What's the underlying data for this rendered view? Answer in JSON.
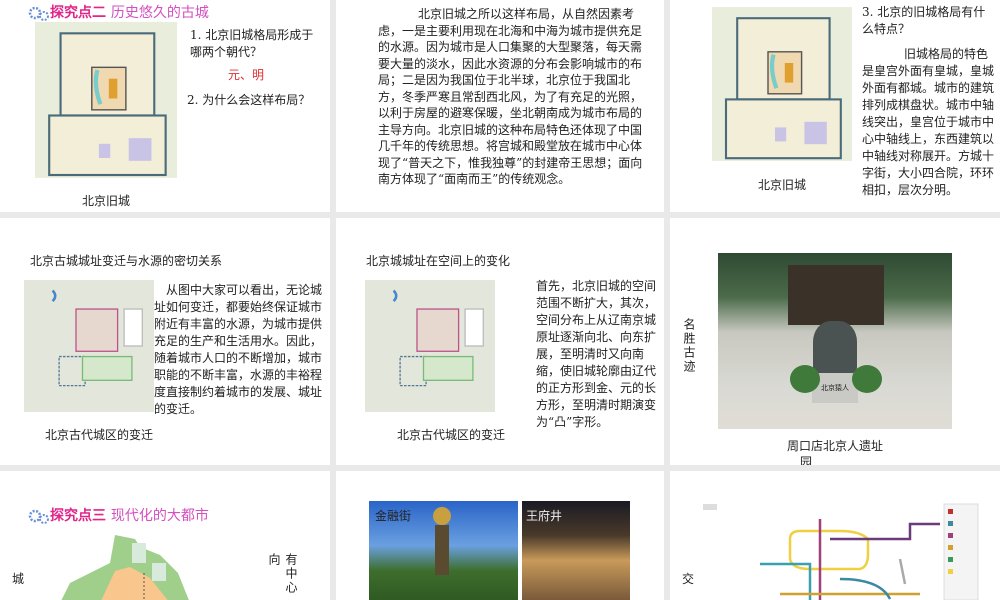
{
  "slide1": {
    "title_bold": "探究点二",
    "title_rest": "历史悠久的古城",
    "q1": "1. 北京旧城格局形成于哪两个朝代？",
    "answer": "元、明",
    "q2": "2. 为什么会这样布局？",
    "caption": "北京旧城"
  },
  "slide2": {
    "text": "北京旧城之所以这样布局，从自然因素考虑，一是主要利用现在北海和中海为城市提供充足的水源。因为城市是人口集聚的大型聚落，每天需要大量的淡水，因此水资源的分布会影响城市的布局；二是因为我国位于北半球，北京位于我国北方，冬季严寒且常刮西北风，为了有充足的光照，以利于房屋的避寒保暖，坐北朝南成为城市布局的主导方向。北京旧城的这种布局特色还体现了中国几千年的传统思想。将宫城和殿堂放在城市中心体现了“普天之下，惟我独尊”的封建帝王思想；面向南方体现了“面南而王”的传统观念。"
  },
  "slide3": {
    "q3": "3. 北京的旧城格局有什么特点？",
    "text": "旧城格局的特色是皇宫外面有皇城，皇城外面有都城。城市的建筑排列成棋盘状。城市中轴线突出，皇宫位于城市中心中轴线上，东西建筑以中轴线对称展开。方城十字街，大小四合院，环环相扣，层次分明。",
    "caption": "北京旧城"
  },
  "slide4": {
    "heading": "北京古城城址变迁与水源的密切关系",
    "text": "从图中大家可以看出，无论城址如何变迁，都要始终保证城市附近有丰富的水源，为城市提供充足的生产和生活用水。因此，随着城市人口的不断增加，城市职能的不断丰富，水源的丰裕程度直接制约着城市的发展、城址的变迁。",
    "caption": "北京古代城区的变迁"
  },
  "slide5": {
    "heading": "北京城城址在空间上的变化",
    "text": "首先，北京旧城的空间范围不断扩大，其次，空间分布上从辽南京城原址逐渐向北、向东扩展，至明清时又向南缩，使旧城轮廓由辽代的正方形到金、元的长方形，至明清时期演变为“凸”字形。",
    "caption": "北京古代城区的变迁"
  },
  "slide6": {
    "side_label": "名胜古迹",
    "caption": "周口店北京人遗址",
    "caption2": "园",
    "statue_label": "北京猿人"
  },
  "slide7": {
    "title_bold": "探究点三",
    "title_rest": "现代化的大都市",
    "left_label": "城",
    "right_label": "有中心向"
  },
  "slide8": {
    "photo1_label": "金融街",
    "photo2_label": "王府井"
  },
  "slide9": {
    "side_label": "交"
  }
}
